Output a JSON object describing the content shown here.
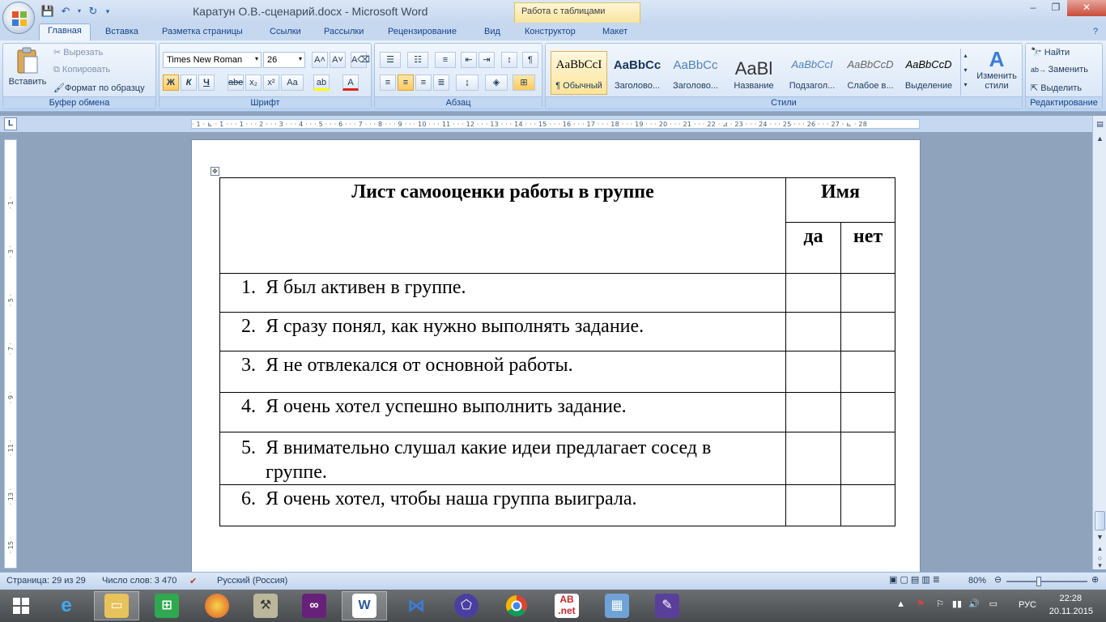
{
  "window": {
    "title": "Каратун О.В.-сценарий.docx - Microsoft Word",
    "context_tab": "Работа с таблицами",
    "minimize": "‒",
    "maximize": "❐",
    "close": "✕"
  },
  "ribbon_tabs": [
    "Главная",
    "Вставка",
    "Разметка страницы",
    "Ссылки",
    "Рассылки",
    "Рецензирование",
    "Вид",
    "Конструктор",
    "Макет"
  ],
  "clipboard": {
    "paste": "Вставить",
    "cut": "Вырезать",
    "copy": "Копировать",
    "format_painter": "Формат по образцу",
    "label": "Буфер обмена"
  },
  "font": {
    "name": "Times New Roman",
    "size": "26",
    "label": "Шрифт",
    "bold": "Ж",
    "italic": "К",
    "underline": "Ч",
    "strike": "abe",
    "subscript": "x₂",
    "superscript": "x²",
    "case": "Aa",
    "grow": "A˄",
    "shrink": "A˅"
  },
  "paragraph": {
    "label": "Абзац",
    "pilcrow": "¶"
  },
  "styles": {
    "label": "Стили",
    "items": [
      {
        "sample": "AaBbCcI",
        "name": "¶ Обычный"
      },
      {
        "sample": "AaBbCc",
        "name": "Заголово..."
      },
      {
        "sample": "AaBbCc",
        "name": "Заголово..."
      },
      {
        "sample": "AaBl",
        "name": "Название"
      },
      {
        "sample": "AaBbCcI",
        "name": "Подзагол..."
      },
      {
        "sample": "AaBbCcD",
        "name": "Слабое в..."
      },
      {
        "sample": "AaBbCcD",
        "name": "Выделение"
      }
    ],
    "change": "Изменить стили"
  },
  "editing": {
    "label": "Редактирование",
    "find": "Найти",
    "replace": "Заменить",
    "select": "Выделить"
  },
  "ruler": {
    "corner": "L",
    "ticks": "· 1 · ⊾ · 1 · · · 1 · · · 2 · · · 3 · · · 4 · · · 5 · · · 6 · · · 7 · · · 8 · · · 9 · · · 10 · · · 11 · · · 12 · · · 13 · · · 14 · · · 15 · · · 16 · · · 17 · · · 18 · · · 19 · · · 20 · · · 21 · · · 22 · ⊿ · 23 · · · 24 · · · 25 · · · 26 · · · 27 · ⊾ · 28"
  },
  "table": {
    "title": "Лист самооценки работы в группе",
    "name_header": "Имя",
    "yes": "да",
    "no": "нет",
    "rows": [
      {
        "num": "1.",
        "text": "Я был активен в группе."
      },
      {
        "num": "2.",
        "text": "Я сразу понял, как нужно выполнять задание."
      },
      {
        "num": "3.",
        "text": "Я не отвлекался от основной работы."
      },
      {
        "num": "4.",
        "text": "Я очень хотел успешно выполнить задание."
      },
      {
        "num": "5.",
        "text": "Я внимательно слушал какие идеи предлагает сосед в группе."
      },
      {
        "num": "6.",
        "text": "Я очень хотел, чтобы наша группа выиграла."
      }
    ]
  },
  "status": {
    "page": "Страница: 29 из 29",
    "words": "Число слов: 3 470",
    "language": "Русский (Россия)",
    "zoom": "80%"
  },
  "tray": {
    "lang": "РУС",
    "time": "22:28",
    "date": "20.11.2015"
  },
  "colors": {
    "ribbon_blue": "#c6d8ef",
    "highlight": "#ffe59a",
    "font_red": "#e02020"
  }
}
